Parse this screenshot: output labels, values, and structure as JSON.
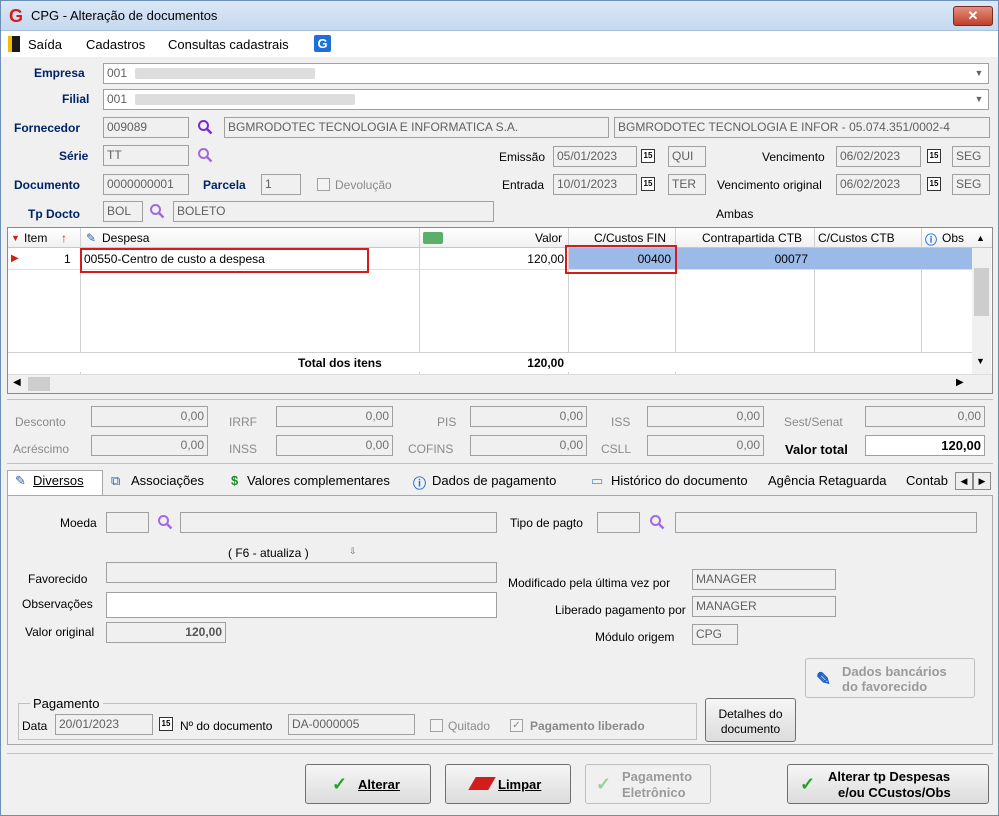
{
  "window": {
    "title": "CPG - Alteração de documentos",
    "close": "✕"
  },
  "menu": {
    "saida": "Saída",
    "cadastros": "Cadastros",
    "consultas": "Consultas cadastrais"
  },
  "header": {
    "empresa_label": "Empresa",
    "empresa_value": "001",
    "filial_label": "Filial",
    "filial_value": "001",
    "fornecedor_label": "Fornecedor",
    "fornecedor_code": "009089",
    "fornecedor_name": "BGMRODOTEC TECNOLOGIA E INFORMATICA S.A.",
    "fornecedor_full": "BGMRODOTEC TECNOLOGIA E INFOR - 05.074.351/0002-4",
    "serie_label": "Série",
    "serie_value": "TT",
    "emissao_label": "Emissão",
    "emissao_date": "05/01/2023",
    "emissao_day": "QUI",
    "vencimento_label": "Vencimento",
    "vencimento_date": "06/02/2023",
    "vencimento_day": "SEG",
    "documento_label": "Documento",
    "documento_value": "0000000001",
    "parcela_label": "Parcela",
    "parcela_value": "1",
    "devolucao_label": "Devolução",
    "entrada_label": "Entrada",
    "entrada_date": "10/01/2023",
    "entrada_day": "TER",
    "venc_original_label": "Vencimento original",
    "venc_original_date": "06/02/2023",
    "venc_original_day": "SEG",
    "tpdocto_label": "Tp Docto",
    "tpdocto_code": "BOL",
    "tpdocto_name": "BOLETO",
    "ambas": "Ambas"
  },
  "grid": {
    "columns": {
      "item": "Item",
      "despesa": "Despesa",
      "valor": "Valor",
      "ccustos_fin": "C/Custos FIN",
      "contrapartida": "Contrapartida CTB",
      "ccustos_ctb": "C/Custos CTB",
      "obs": "Obs"
    },
    "rows": [
      {
        "item": "1",
        "despesa": "00550-Centro de custo a despesa",
        "valor": "120,00",
        "ccustos_fin": "00400",
        "contrapartida": "00077"
      }
    ],
    "total_label": "Total dos itens",
    "total_value": "120,00"
  },
  "totals": {
    "desconto_label": "Desconto",
    "desconto": "0,00",
    "irrf_label": "IRRF",
    "irrf": "0,00",
    "pis_label": "PIS",
    "pis": "0,00",
    "iss_label": "ISS",
    "iss": "0,00",
    "sest_label": "Sest/Senat",
    "sest": "0,00",
    "acrescimo_label": "Acréscimo",
    "acrescimo": "0,00",
    "inss_label": "INSS",
    "inss": "0,00",
    "cofins_label": "COFINS",
    "cofins": "0,00",
    "csll_label": "CSLL",
    "csll": "0,00",
    "valor_total_label": "Valor total",
    "valor_total": "120,00"
  },
  "tabs": [
    "Diversos",
    "Associações",
    "Valores complementares",
    "Dados de pagamento",
    "Histórico do documento",
    "Agência Retaguarda",
    "Contab"
  ],
  "diversos": {
    "moeda_label": "Moeda",
    "f6": "( F6 - atualiza )",
    "tipo_pagto_label": "Tipo de pagto",
    "favorecido_label": "Favorecido",
    "observacoes_label": "Observações",
    "valor_original_label": "Valor original",
    "valor_original": "120,00",
    "modificado_label": "Modificado pela última vez por",
    "modificado_value": "MANAGER",
    "liberado_label": "Liberado pagamento por",
    "liberado_value": "MANAGER",
    "modulo_label": "Módulo origem",
    "modulo_value": "CPG",
    "dados_bancarios_l1": "Dados bancários",
    "dados_bancarios_l2": "do favorecido",
    "pagamento_group": "Pagamento",
    "data_label": "Data",
    "data_value": "20/01/2023",
    "nro_doc_label": "Nº do documento",
    "nro_doc_value": "DA-0000005",
    "quitado_label": "Quitado",
    "pag_liberado_label": "Pagamento liberado",
    "detalhes_l1": "Detalhes do",
    "detalhes_l2": "documento"
  },
  "buttons": {
    "alterar": "Alterar",
    "limpar": "Limpar",
    "pag_eletronico_l1": "Pagamento",
    "pag_eletronico_l2": "Eletrônico",
    "alterar_tp_l1": "Alterar tp Despesas",
    "alterar_tp_l2": "e/ou CCustos/Obs"
  }
}
